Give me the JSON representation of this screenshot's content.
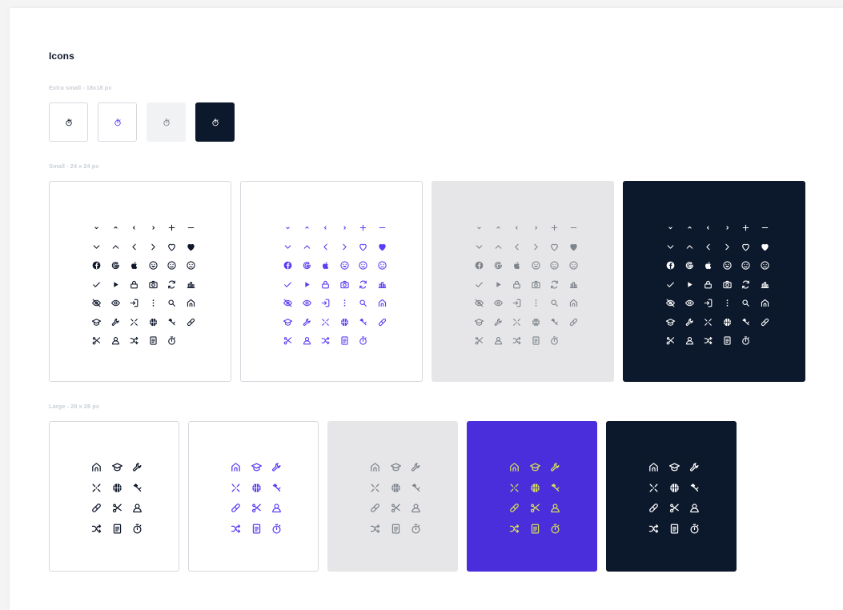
{
  "page": {
    "title": "Icons",
    "sections": {
      "extra_small": "Extra small - 18x18 px",
      "small": "Small - 24 x 24 px",
      "large": "Large - 28 x 28 px"
    }
  },
  "colors": {
    "dark": "#0f172a",
    "purple": "#5b3df5",
    "purple_bg": "#4a2ddb",
    "grey": "#7e848c",
    "grey_bg": "#e6e6e8",
    "navy_bg": "#0c182b",
    "lime": "#d4e157",
    "border": "#d5d9de"
  },
  "extra_small": {
    "icon": "stopwatch-icon",
    "variants": [
      "white-outline",
      "white-purple",
      "light-grey",
      "navy"
    ]
  },
  "small": {
    "variants": [
      "white-dark",
      "white-purple",
      "grey",
      "navy"
    ],
    "icons": [
      "chevron-down-small-icon",
      "chevron-up-small-icon",
      "chevron-left-small-icon",
      "chevron-right-small-icon",
      "plus-icon",
      "minus-icon",
      "chevron-down-icon",
      "chevron-up-icon",
      "chevron-left-icon",
      "chevron-right-icon",
      "heart-outline-icon",
      "heart-filled-icon",
      "facebook-icon",
      "google-icon",
      "apple-icon",
      "smile-icon",
      "neutral-face-icon",
      "sad-face-icon",
      "check-icon",
      "play-icon",
      "lock-icon",
      "camera-icon",
      "refresh-icon",
      "chart-icon",
      "eye-off-icon",
      "eye-icon",
      "login-icon",
      "more-vertical-icon",
      "search-icon",
      "home-icon",
      "graduation-cap-icon",
      "wrench-icon",
      "tools-icon",
      "basketball-icon",
      "hammer-icon",
      "bandage-icon",
      "scissors-icon",
      "user-icon",
      "shuffle-icon",
      "document-icon",
      "stopwatch-icon"
    ]
  },
  "large": {
    "variants": [
      "white-dark",
      "white-purple",
      "grey",
      "purple-lime",
      "navy"
    ],
    "icons": [
      "home-icon",
      "graduation-cap-icon",
      "wrench-icon",
      "tools-icon",
      "basketball-icon",
      "hammer-icon",
      "bandage-icon",
      "scissors-icon",
      "user-icon",
      "shuffle-icon",
      "document-icon",
      "stopwatch-icon"
    ]
  }
}
